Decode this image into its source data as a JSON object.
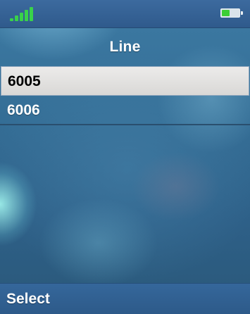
{
  "status_bar": {
    "signal_icon": "signal-strength-icon",
    "signal_level": 5,
    "battery_icon": "battery-icon",
    "battery_level": 0.42,
    "signal_color": "#39d24a",
    "battery_color": "#3ccf35"
  },
  "title": "Line",
  "lines": [
    {
      "label": "6005",
      "selected": true
    },
    {
      "label": "6006",
      "selected": false
    }
  ],
  "soft_keys": {
    "left_label": "Select"
  },
  "colors": {
    "bar_background": "#2f5a8c",
    "selection_background": "#e3e2e0",
    "text_light": "#ffffff",
    "text_dark": "#000000"
  }
}
